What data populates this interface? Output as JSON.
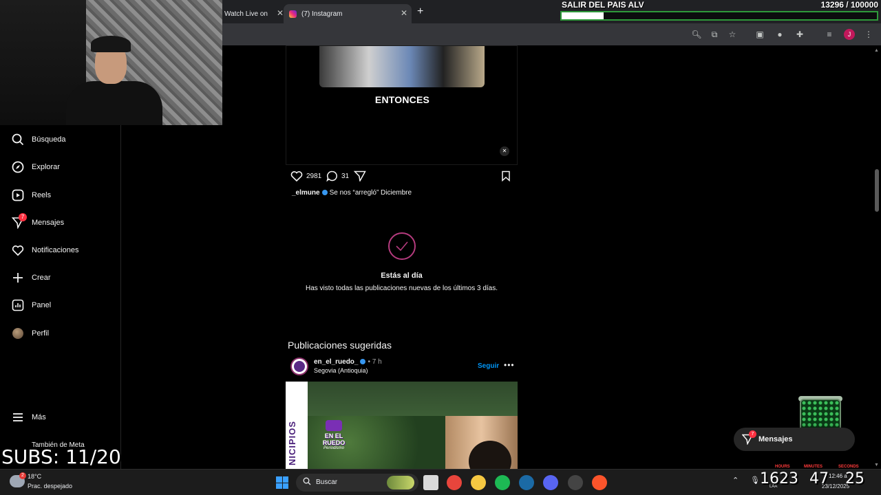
{
  "browser": {
    "tabs": [
      {
        "label": "Watch Live on",
        "active": false
      },
      {
        "label": "(7) Instagram",
        "active": true
      }
    ],
    "new_tab": "+",
    "close_glyph": "✕",
    "profile_initial": "J",
    "toolbar_icons": [
      "zoom-icon",
      "cast-icon",
      "bookmark-star-icon",
      "extension-icon",
      "vpn-icon",
      "puzzle-icon",
      "media-icon"
    ]
  },
  "goal": {
    "title": "SALIR DEL PAIS ALV",
    "count": "13296  / 100000",
    "progress": 0.133,
    "bar_color": "#2e9a3a"
  },
  "sidebar": {
    "items": [
      {
        "label": "Búsqueda",
        "icon": "search-icon"
      },
      {
        "label": "Explorar",
        "icon": "compass-icon"
      },
      {
        "label": "Reels",
        "icon": "reels-icon"
      },
      {
        "label": "Mensajes",
        "icon": "messenger-icon",
        "badge": "7"
      },
      {
        "label": "Notificaciones",
        "icon": "heart-icon"
      },
      {
        "label": "Crear",
        "icon": "plus-icon"
      },
      {
        "label": "Panel",
        "icon": "panel-icon"
      },
      {
        "label": "Perfil",
        "icon": "profile-avatar"
      }
    ],
    "more": "Más",
    "meta": "También de Meta"
  },
  "post_top": {
    "video_caption": "ENTONCES",
    "likes": "2981",
    "comments": "31",
    "username": "_elmune",
    "caption": "Se nos “arregló” Diciembre"
  },
  "caught_up": {
    "title": "Estás al día",
    "subtitle": "Has visto todas las publicaciones nuevas de los últimos 3 días."
  },
  "suggested": {
    "title": "Publicaciones sugeridas",
    "username": "en_el_ruedo_",
    "time": "• 7 h",
    "location": "Segovia (Antioquia)",
    "follow": "Seguir",
    "more": "•••",
    "media_text": "NICIPIOS",
    "logo_title": "EN EL RUEDO",
    "logo_sub": "Periodismo"
  },
  "messages_pill": {
    "label": "Mensajes",
    "badge": "7"
  },
  "overlay": {
    "subs": "SUBS: 11/20"
  },
  "taskbar": {
    "weather_temp": "18°C",
    "weather_desc": "Prac. despejado",
    "weather_badge": "2",
    "search_label": "Buscar",
    "apps": [
      {
        "icon": "file-icon",
        "color": "#d9d9d9"
      },
      {
        "icon": "chrome-icon",
        "color": "#e8453c"
      },
      {
        "icon": "folder-icon",
        "color": "#f5c842"
      },
      {
        "icon": "spotify-icon",
        "color": "#1db954"
      },
      {
        "icon": "steam-icon",
        "color": "#1b6aa5"
      },
      {
        "icon": "discord-icon",
        "color": "#5865f2"
      },
      {
        "icon": "obs-icon",
        "color": "#444444"
      },
      {
        "icon": "brave-icon",
        "color": "#fb542b"
      }
    ],
    "lang": "LAA",
    "time": "12:46 a",
    "date": "23/12/2025"
  },
  "timer": {
    "labels": [
      "HOURS",
      "MINUTES",
      "SECONDS"
    ],
    "hours": "1623",
    "minutes": "47",
    "seconds": "25"
  }
}
